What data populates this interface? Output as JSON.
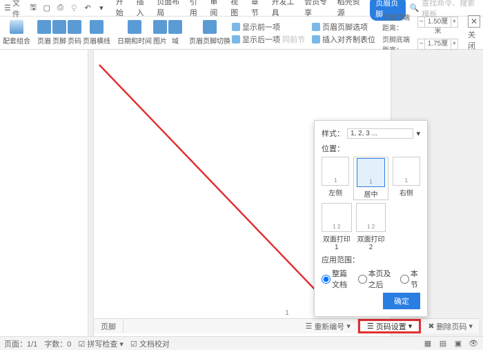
{
  "menubar": {
    "file": "文件",
    "tabs": [
      "开始",
      "插入",
      "页面布局",
      "引用",
      "审阅",
      "视图",
      "章节",
      "开发工具",
      "会员专享",
      "稻壳资源",
      "页眉页脚"
    ],
    "active_tab": 10,
    "search_placeholder": "查找命令、搜索模板"
  },
  "ribbon": {
    "groups": {
      "combo": {
        "label": "配套组合"
      },
      "header": {
        "label": "页眉"
      },
      "footer": {
        "label": "页脚"
      },
      "pagenum": {
        "label": "页码"
      },
      "hfline": {
        "label": "页眉横线"
      },
      "datetime": {
        "label": "日期和时间"
      },
      "picture": {
        "label": "图片"
      },
      "field": {
        "label": "域"
      },
      "switch": {
        "label": "页眉页脚切换"
      },
      "showprev": {
        "label": "显示前一项"
      },
      "shownext": {
        "label": "显示后一项"
      },
      "samenext": {
        "label": "同前节"
      },
      "hfoptions": {
        "label": "页眉页脚选项"
      },
      "inserttab": {
        "label": "插入对齐制表位"
      },
      "topdist": {
        "label": "页眉顶端距离：",
        "value": "1.50厘米"
      },
      "botdist": {
        "label": "页脚底端距离：",
        "value": "1.75厘米"
      },
      "close": {
        "label": "关闭"
      }
    }
  },
  "popup": {
    "style_label": "样式：",
    "style_value": "1, 2, 3 ...",
    "position_label": "位置：",
    "thumbs_row1": [
      {
        "caption": "左侧",
        "num": "1"
      },
      {
        "caption": "居中",
        "num": "1"
      },
      {
        "caption": "右侧",
        "num": "1"
      }
    ],
    "thumbs_row2": [
      {
        "caption": "双面打印1",
        "num": "1   2"
      },
      {
        "caption": "双面打印2",
        "num": "1   2"
      }
    ],
    "scope_label": "应用范围：",
    "scope_options": [
      "整篇文档",
      "本页及之后",
      "本节"
    ],
    "ok": "确定"
  },
  "footer_toolbar": {
    "footer_tab": "页脚",
    "renumber": "重新编号",
    "pagenum_settings": "页码设置",
    "delete_pagenum": "删除页码",
    "page_display": "1"
  },
  "statusbar": {
    "page": "页面：1/1",
    "words": "字数：0",
    "spell": "拼写检查",
    "proof": "文档校对"
  }
}
